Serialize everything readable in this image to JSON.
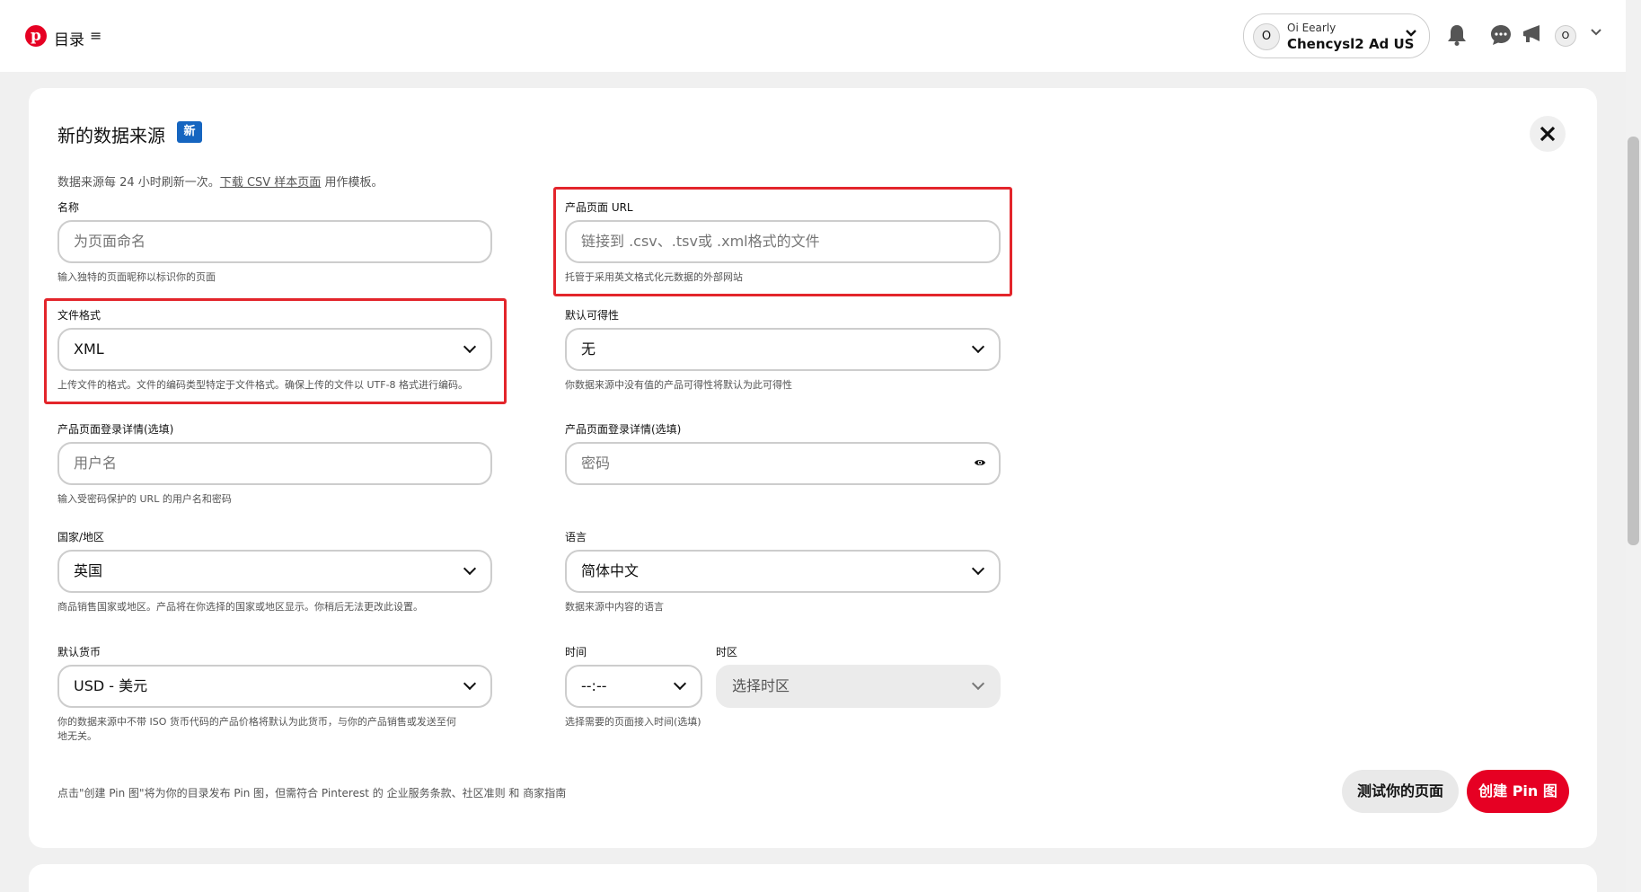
{
  "topbar": {
    "logo_letter": "p",
    "catalog": "目录",
    "menu_glyph": "≡",
    "account_avatar": "O",
    "account_small": "Oi Eearly",
    "account_name": "Chencysl2 Ad US",
    "user_avatar": "O"
  },
  "form": {
    "title": "新的数据来源",
    "new_badge": "新",
    "intro_text": "数据来源每 24 小时刷新一次。",
    "intro_link": "下载 CSV 样本页面",
    "intro_suffix": " 用作模板。",
    "name": {
      "label": "名称",
      "placeholder": "为页面命名",
      "help": "输入独特的页面昵称以标识你的页面"
    },
    "url": {
      "label": "产品页面 URL",
      "placeholder": "链接到 .csv、.tsv或 .xml格式的文件",
      "help": "托管于采用英文格式化元数据的外部网站"
    },
    "format": {
      "label": "文件格式",
      "value": "XML",
      "help": "上传文件的格式。文件的编码类型特定于文件格式。确保上传的文件以 UTF-8 格式进行编码。"
    },
    "availability": {
      "label": "默认可得性",
      "value": "无",
      "help": "你数据来源中没有值的产品可得性将默认为此可得性"
    },
    "login_user": {
      "label": "产品页面登录详情(选填)",
      "placeholder": "用户名",
      "help": "输入受密码保护的 URL 的用户名和密码"
    },
    "login_pass": {
      "label": "产品页面登录详情(选填)",
      "placeholder": "密码"
    },
    "country": {
      "label": "国家/地区",
      "value": "英国",
      "help": "商品销售国家或地区。产品将在你选择的国家或地区显示。你稍后无法更改此设置。"
    },
    "language": {
      "label": "语言",
      "value": "简体中文",
      "help": "数据来源中内容的语言"
    },
    "currency": {
      "label": "默认货币",
      "value": "USD - 美元",
      "help_line1": "你的数据来源中不带 ISO 货币代码的产品价格将默认为此货币，与你的产品销售或发送至何",
      "help_line2": "地无关。"
    },
    "time": {
      "label": "时间",
      "value": "--:--",
      "help": "选择需要的页面接入时间(选填)"
    },
    "timezone": {
      "label": "时区",
      "value": "选择时区"
    }
  },
  "footer": {
    "note": "点击\"创建 Pin 图\"将为你的目录发布 Pin 图，但需符合 Pinterest 的 企业服务条款、社区准则 和 商家指南",
    "test_button": "测试你的页面",
    "create_button": "创建 Pin 图"
  },
  "colors": {
    "brand": "#e60023",
    "badge": "#1565c0",
    "highlight_box": "#e3252b"
  }
}
